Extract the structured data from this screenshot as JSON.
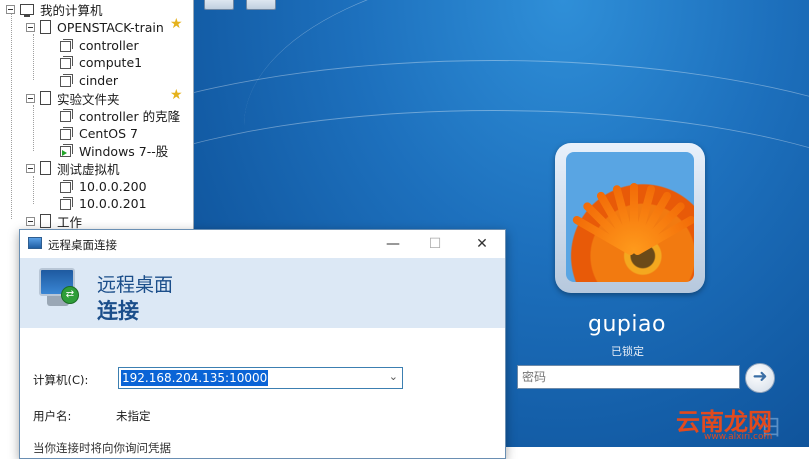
{
  "tree": {
    "root": "我的计算机",
    "groups": [
      {
        "label": "OPENSTACK-train",
        "starred": true,
        "items": [
          "controller",
          "compute1",
          "cinder"
        ]
      },
      {
        "label": "实验文件夹",
        "starred": true,
        "items": [
          "controller 的克隆",
          "CentOS 7",
          "Windows 7--股"
        ]
      },
      {
        "label": "测试虚拟机",
        "starred": false,
        "items": [
          "10.0.0.200",
          "10.0.0.201"
        ]
      },
      {
        "label": "工作",
        "starred": false,
        "items": []
      }
    ]
  },
  "lockscreen": {
    "username": "gupiao",
    "status": "已锁定",
    "password_placeholder": "密码",
    "go_icon": "arrow-right-icon"
  },
  "dialog": {
    "title": "远程桌面连接",
    "minimize": "—",
    "maximize": "☐",
    "close": "✕",
    "header_line1": "远程桌面",
    "header_line2": "连接",
    "computer_label": "计算机(C):",
    "computer_value": "192.168.204.135:10000",
    "username_label": "用户名:",
    "username_value": "未指定",
    "hint_text": "当你连接时将向你询问凭据"
  },
  "watermark": {
    "logo_text": "云南龙网",
    "url": "www.alxiri.com"
  },
  "colors": {
    "desktop_blue": "#1d70bd",
    "dialog_header": "#dce8f5",
    "selection": "#0a64d6",
    "watermark": "#e24a1e"
  }
}
